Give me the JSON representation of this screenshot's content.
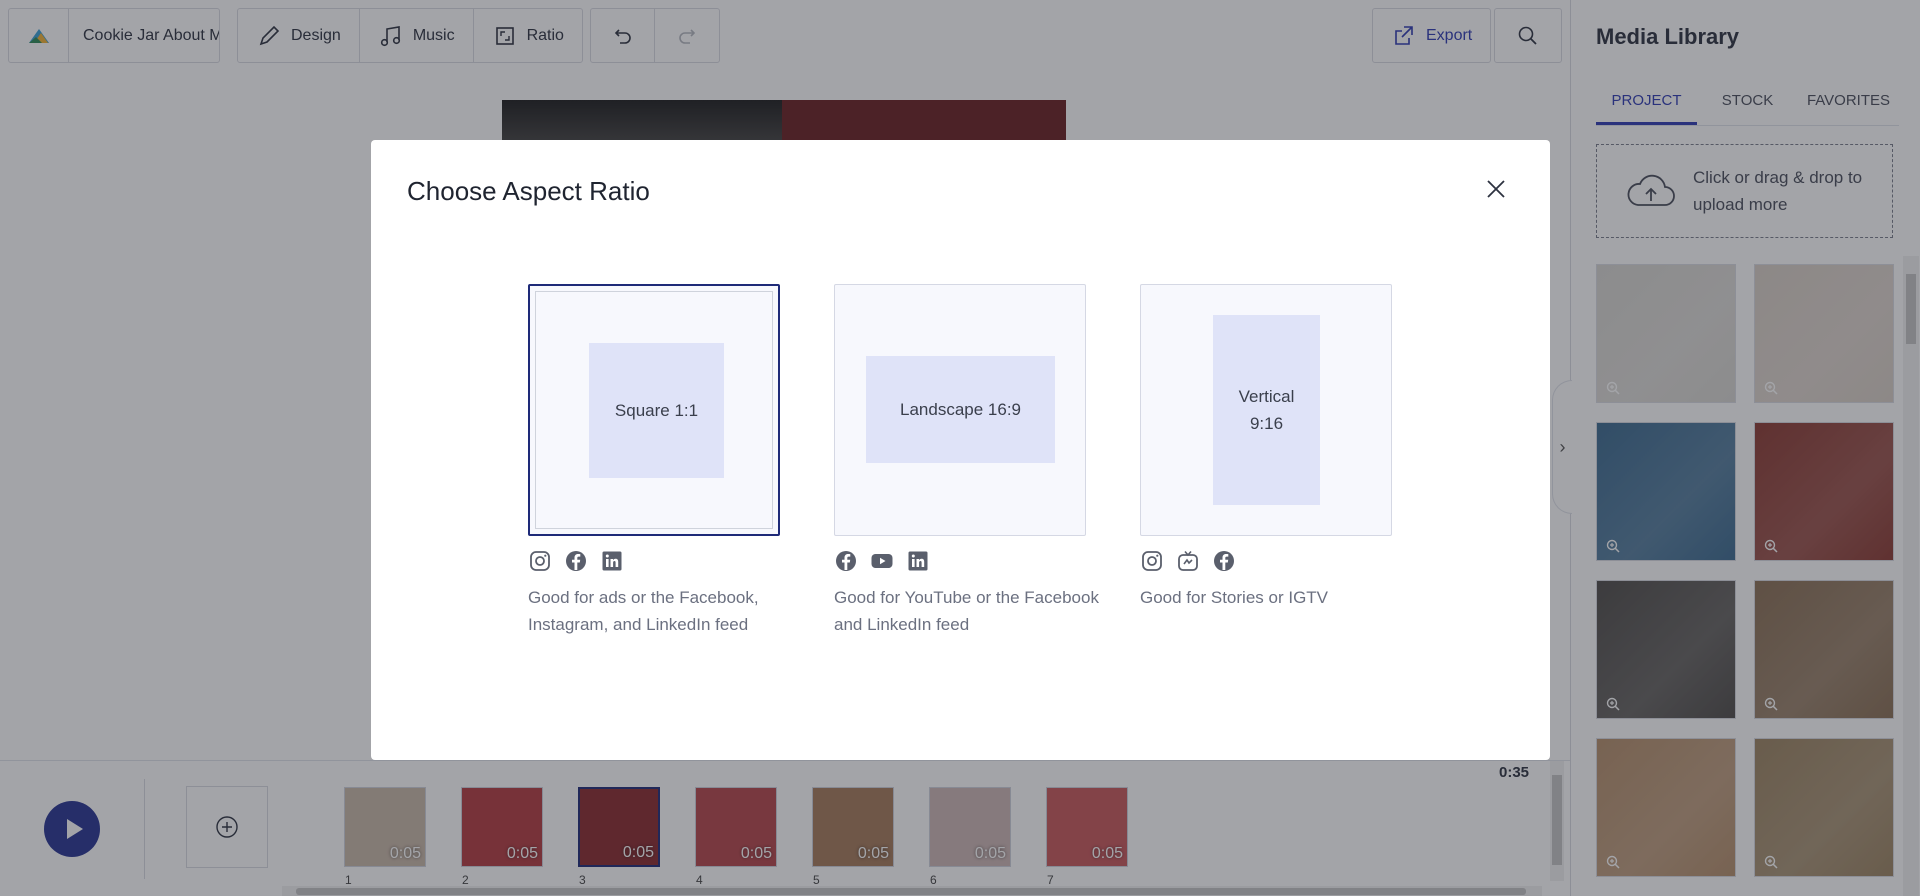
{
  "toolbar": {
    "project_name": "Cookie Jar About M",
    "design_label": "Design",
    "music_label": "Music",
    "ratio_label": "Ratio",
    "export_label": "Export"
  },
  "timeline": {
    "total_duration": "0:35",
    "scenes": [
      {
        "num": "1",
        "dur": "0:05",
        "color": "#c9b8a8"
      },
      {
        "num": "2",
        "dur": "0:05",
        "color": "#b33b40"
      },
      {
        "num": "3",
        "dur": "0:05",
        "color": "#8a2a2e",
        "selected": true
      },
      {
        "num": "4",
        "dur": "0:05",
        "color": "#b6464b"
      },
      {
        "num": "5",
        "dur": "0:05",
        "color": "#a57a5a"
      },
      {
        "num": "6",
        "dur": "0:05",
        "color": "#cdb7b5"
      },
      {
        "num": "7",
        "dur": "0:05",
        "color": "#c9585b"
      }
    ]
  },
  "media_panel": {
    "title": "Media Library",
    "tabs": [
      "PROJECT",
      "STOCK",
      "FAVORITES"
    ],
    "active_tab": "PROJECT",
    "upload_text": "Click or drag & drop to upload more",
    "items": [
      {
        "color": "#d8d6d1"
      },
      {
        "color": "#d9cfc6"
      },
      {
        "color": "#3c6a8f"
      },
      {
        "color": "#8b3a32"
      },
      {
        "color": "#4f4c49"
      },
      {
        "color": "#8a6f54"
      },
      {
        "color": "#b58f6b"
      },
      {
        "color": "#9c8461"
      }
    ]
  },
  "modal": {
    "title": "Choose Aspect Ratio",
    "options": [
      {
        "label": "Square 1:1",
        "description": "Good for ads or the Facebook, Instagram, and LinkedIn feed",
        "icons": [
          "instagram-icon",
          "facebook-icon",
          "linkedin-icon"
        ],
        "selected": true
      },
      {
        "label": "Landscape 16:9",
        "description": "Good for YouTube or the Facebook and LinkedIn feed",
        "icons": [
          "facebook-icon",
          "youtube-icon",
          "linkedin-icon"
        ],
        "selected": false
      },
      {
        "label_line1": "Vertical",
        "label_line2": "9:16",
        "description": "Good for Stories or IGTV",
        "icons": [
          "instagram-icon",
          "igtv-icon",
          "facebook-icon"
        ],
        "selected": false
      }
    ]
  }
}
